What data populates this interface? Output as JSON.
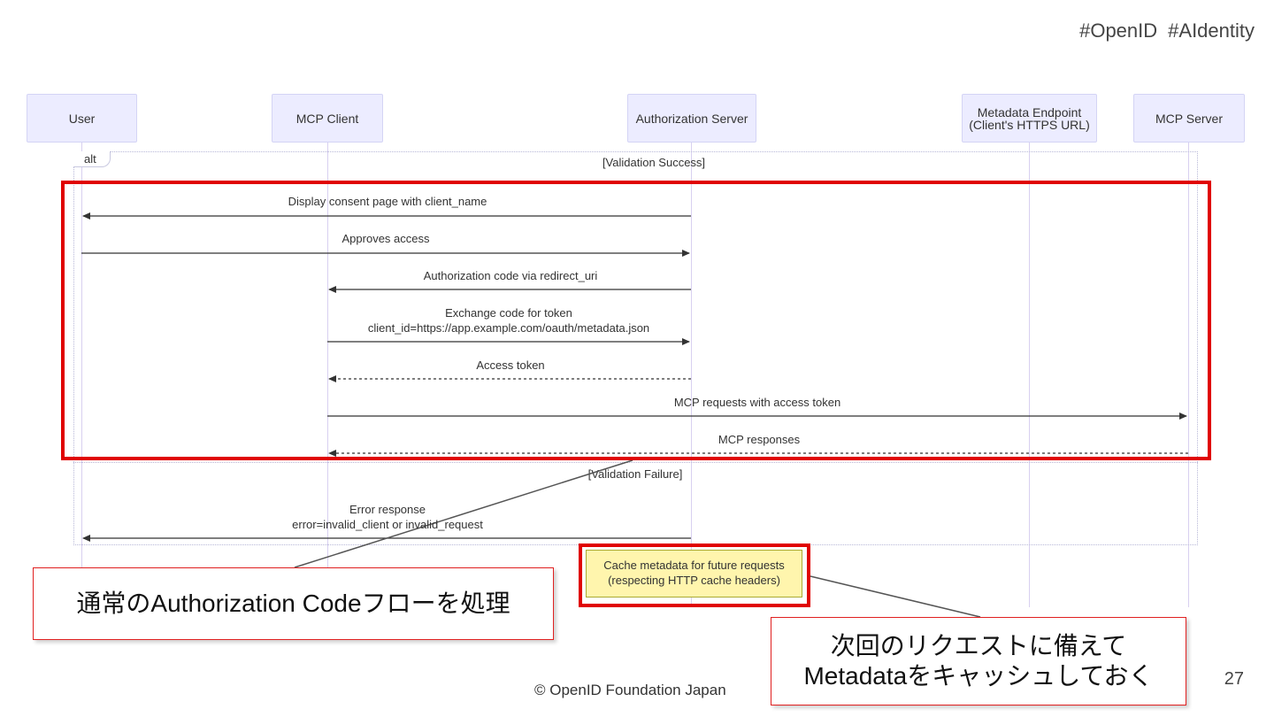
{
  "tags": [
    "#OpenID",
    "#AIdentity"
  ],
  "participants": [
    {
      "id": "user",
      "label": "User"
    },
    {
      "id": "client",
      "label": "MCP Client"
    },
    {
      "id": "auth",
      "label": "Authorization Server"
    },
    {
      "id": "meta",
      "label": "Metadata Endpoint\n(Client's HTTPS URL)"
    },
    {
      "id": "server",
      "label": "MCP Server"
    }
  ],
  "alt": {
    "tag": "alt",
    "success_condition": "[Validation Success]",
    "failure_condition": "[Validation Failure]"
  },
  "messages": [
    {
      "from": "auth",
      "to": "user",
      "style": "solid",
      "label": "Display consent page with client_name"
    },
    {
      "from": "user",
      "to": "auth",
      "style": "solid",
      "label": "Approves access"
    },
    {
      "from": "auth",
      "to": "client",
      "style": "solid",
      "label": "Authorization code via redirect_uri"
    },
    {
      "from": "client",
      "to": "auth",
      "style": "solid",
      "label": "Exchange code for token\nclient_id=https://app.example.com/oauth/metadata.json"
    },
    {
      "from": "auth",
      "to": "client",
      "style": "dashed",
      "label": "Access token"
    },
    {
      "from": "client",
      "to": "server",
      "style": "solid",
      "label": "MCP requests with access token"
    },
    {
      "from": "server",
      "to": "client",
      "style": "dashed",
      "label": "MCP responses"
    },
    {
      "from": "auth",
      "to": "user",
      "style": "solid",
      "label": "Error response\nerror=invalid_client or invalid_request"
    }
  ],
  "note": "Cache metadata for future requests\n(respecting HTTP cache headers)",
  "callouts": {
    "flow": "通常のAuthorization Codeフローを処理",
    "cache": "次回のリクエストに備えて\nMetadataをキャッシュしておく"
  },
  "footer": "© OpenID Foundation Japan",
  "page_number": "27",
  "colors": {
    "highlight": "#e00000",
    "participant_fill": "#ececff",
    "note_fill": "#fff5ad"
  }
}
